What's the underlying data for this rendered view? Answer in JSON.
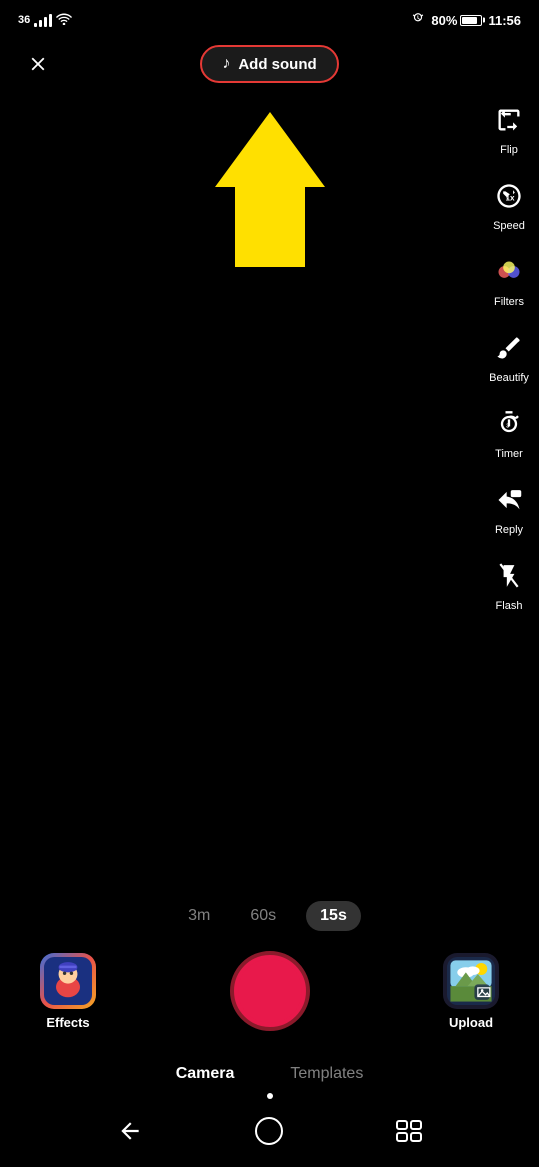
{
  "status_bar": {
    "network": "36",
    "battery_percent": "80%",
    "time": "11:56"
  },
  "top_controls": {
    "close_label": "✕",
    "add_sound_label": "Add sound"
  },
  "right_sidebar": {
    "items": [
      {
        "id": "flip",
        "label": "Flip",
        "icon": "flip"
      },
      {
        "id": "speed",
        "label": "Speed",
        "icon": "speed"
      },
      {
        "id": "filters",
        "label": "Filters",
        "icon": "filters"
      },
      {
        "id": "beautify",
        "label": "Beautify",
        "icon": "beautify"
      },
      {
        "id": "timer",
        "label": "Timer",
        "icon": "timer"
      },
      {
        "id": "reply",
        "label": "Reply",
        "icon": "reply"
      },
      {
        "id": "flash",
        "label": "Flash",
        "icon": "flash"
      }
    ]
  },
  "duration_options": [
    {
      "label": "3m",
      "active": false
    },
    {
      "label": "60s",
      "active": false
    },
    {
      "label": "15s",
      "active": true
    }
  ],
  "effects": {
    "label": "Effects"
  },
  "upload": {
    "label": "Upload"
  },
  "tabs": [
    {
      "label": "Camera",
      "active": true
    },
    {
      "label": "Templates",
      "active": false
    }
  ]
}
